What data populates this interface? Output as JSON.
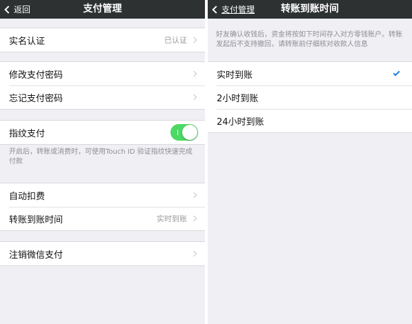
{
  "colors": {
    "navbar": "#2e3132",
    "background": "#efeff4",
    "toggle_on": "#4cd964",
    "checkmark": "#1d7fe2"
  },
  "left": {
    "back_label": "返回",
    "title": "支付管理",
    "realname": {
      "label": "实名认证",
      "value": "已认证"
    },
    "change_password": {
      "label": "修改支付密码"
    },
    "forgot_password": {
      "label": "忘记支付密码"
    },
    "fingerprint": {
      "label": "指纹支付",
      "toggle_on": true,
      "footnote": "开启后，转账或消费时，可使用Touch ID 验证指纹快速完成付款"
    },
    "auto_deduct": {
      "label": "自动扣费"
    },
    "transfer_time": {
      "label": "转账到账时间",
      "value": "实时到账"
    },
    "cancel_wechat_pay": {
      "label": "注销微信支付"
    }
  },
  "right": {
    "back_label": "支付管理",
    "title": "转账到账时间",
    "description": "好友确认收钱后，资金将按如下时间存入对方零钱账户。转账发起后不支持撤回，请转账前仔细核对收款人信息",
    "options": [
      {
        "label": "实时到账",
        "selected": true
      },
      {
        "label": "2小时到账",
        "selected": false
      },
      {
        "label": "24小时到账",
        "selected": false
      }
    ]
  }
}
